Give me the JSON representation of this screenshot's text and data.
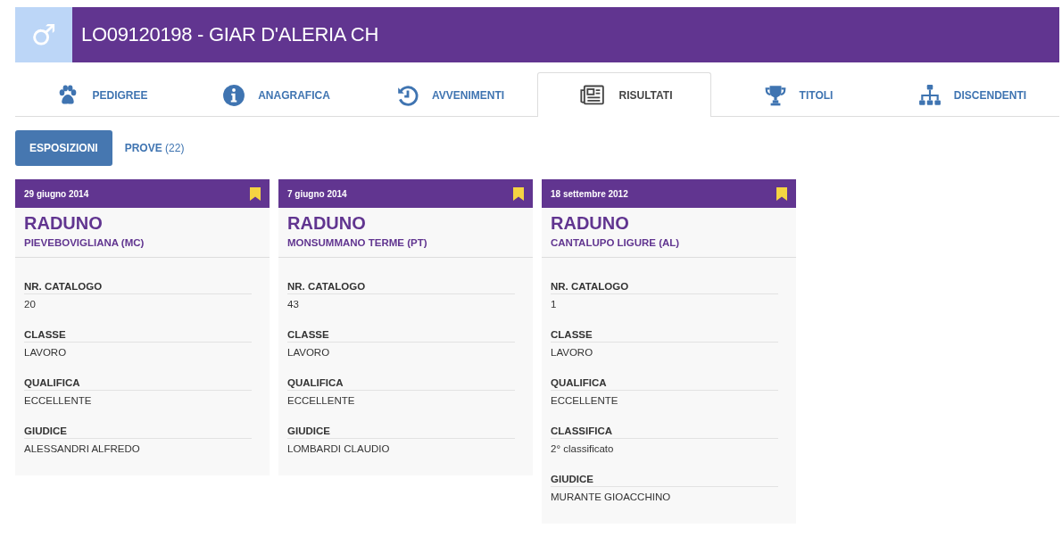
{
  "header": {
    "sex_symbol": "♂",
    "title": "LO09120198 - GIAR D'ALERIA CH"
  },
  "tabs": [
    {
      "label": "PEDIGREE",
      "kind": "paw",
      "selected": false
    },
    {
      "label": "ANAGRAFICA",
      "kind": "info",
      "selected": false
    },
    {
      "label": "AVVENIMENTI",
      "kind": "history",
      "selected": false
    },
    {
      "label": "RISULTATI",
      "kind": "news",
      "selected": true
    },
    {
      "label": "TITOLI",
      "kind": "trophy",
      "selected": false
    },
    {
      "label": "DISCENDENTI",
      "kind": "tree",
      "selected": false
    }
  ],
  "subtabs": [
    {
      "label": "ESPOSIZIONI",
      "selected": true
    },
    {
      "label": "**PROVE** (22)",
      "selected": false
    }
  ],
  "cards": [
    {
      "date": "29 giugno 2014",
      "type": "RADUNO",
      "place": "PIEVEBOVIGLIANA (MC)",
      "fields": [
        {
          "label": "NR. CATALOGO",
          "value": "20"
        },
        {
          "label": "CLASSE",
          "value": "LAVORO"
        },
        {
          "label": "QUALIFICA",
          "value": "ECCELLENTE"
        },
        {
          "label": "GIUDICE",
          "value": "ALESSANDRI ALFREDO"
        }
      ]
    },
    {
      "date": "7 giugno 2014",
      "type": "RADUNO",
      "place": "MONSUMMANO TERME (PT)",
      "fields": [
        {
          "label": "NR. CATALOGO",
          "value": "43"
        },
        {
          "label": "CLASSE",
          "value": "LAVORO"
        },
        {
          "label": "QUALIFICA",
          "value": "ECCELLENTE"
        },
        {
          "label": "GIUDICE",
          "value": "LOMBARDI CLAUDIO"
        }
      ]
    },
    {
      "date": "18 settembre 2012",
      "type": "RADUNO",
      "place": "CANTALUPO LIGURE (AL)",
      "fields": [
        {
          "label": "NR. CATALOGO",
          "value": "1"
        },
        {
          "label": "CLASSE",
          "value": "LAVORO"
        },
        {
          "label": "QUALIFICA",
          "value": "ECCELLENTE"
        },
        {
          "label": "CLASSIFICA",
          "value": "2° classificato"
        },
        {
          "label": "GIUDICE",
          "value": "MURANTE GIOACCHINO"
        }
      ]
    }
  ]
}
